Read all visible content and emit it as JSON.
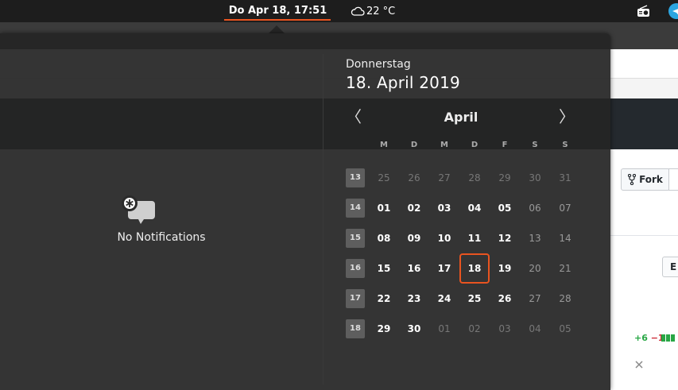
{
  "topbar": {
    "clock": "Do Apr 18, 17:51",
    "weather": "22 °C"
  },
  "background": {
    "fork_label": "Fork",
    "edit_label": "E",
    "diff_add": "+6",
    "diff_del": "−1"
  },
  "notifications": {
    "empty_text": "No Notifications"
  },
  "calendar": {
    "weekday_name": "Donnerstag",
    "full_date": "18. April 2019",
    "month": "April",
    "weekday_headers": [
      "M",
      "D",
      "M",
      "D",
      "F",
      "S",
      "S"
    ],
    "weeks": [
      {
        "num": "13",
        "days": [
          "25",
          "26",
          "27",
          "28",
          "29",
          "30",
          "31"
        ]
      },
      {
        "num": "14",
        "days": [
          "01",
          "02",
          "03",
          "04",
          "05",
          "06",
          "07"
        ]
      },
      {
        "num": "15",
        "days": [
          "08",
          "09",
          "10",
          "11",
          "12",
          "13",
          "14"
        ]
      },
      {
        "num": "16",
        "days": [
          "15",
          "16",
          "17",
          "18",
          "19",
          "20",
          "21"
        ]
      },
      {
        "num": "17",
        "days": [
          "22",
          "23",
          "24",
          "25",
          "26",
          "27",
          "28"
        ]
      },
      {
        "num": "18",
        "days": [
          "29",
          "30",
          "01",
          "02",
          "03",
          "04",
          "05"
        ]
      }
    ],
    "today": "18"
  },
  "colors": {
    "accent": "#e95420",
    "panel": "#1d1d1d",
    "popover": "#252525"
  }
}
